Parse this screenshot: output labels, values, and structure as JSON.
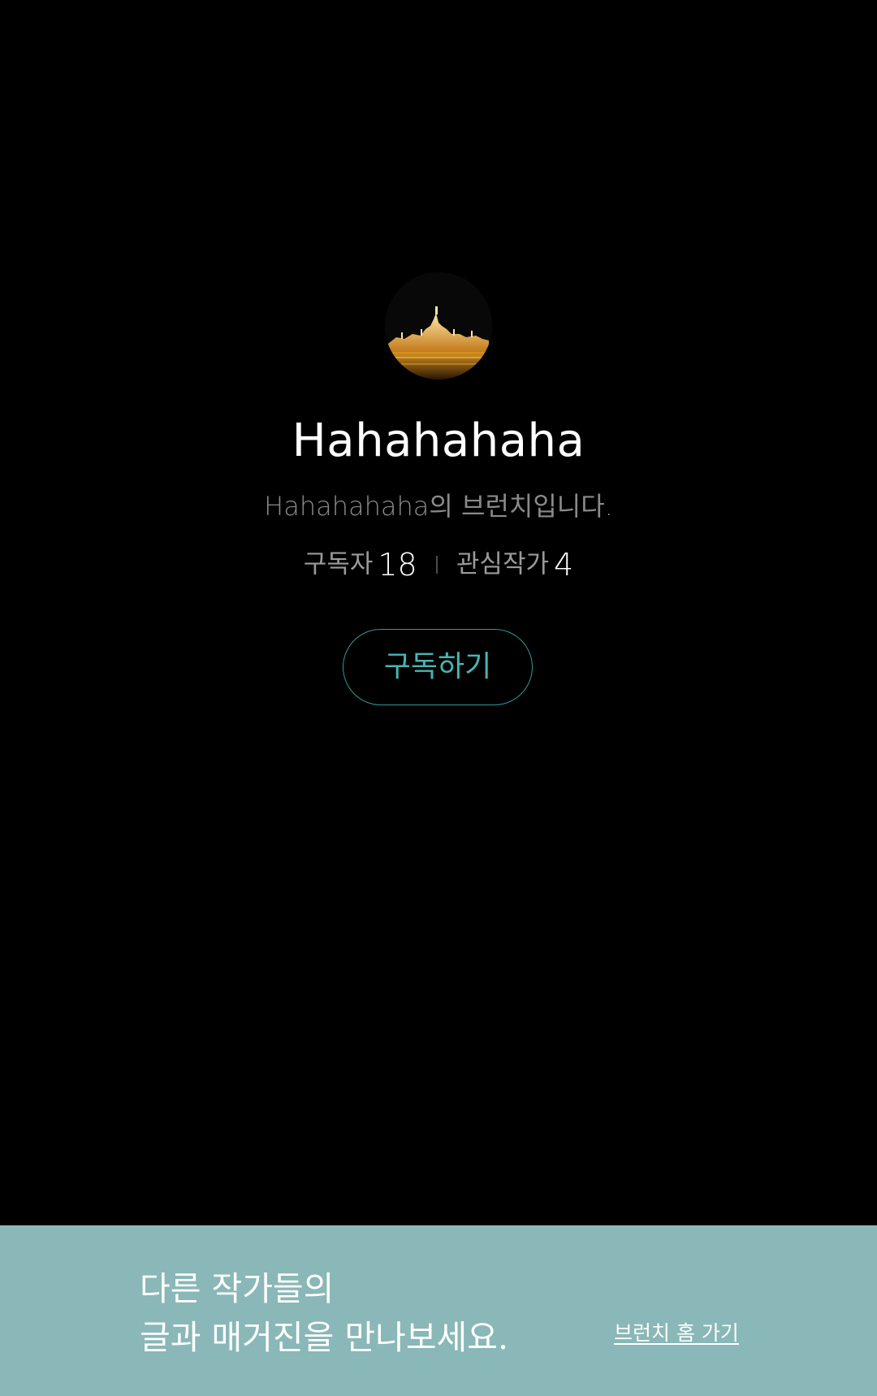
{
  "profile": {
    "avatar_icon": "budapest-parliament-night-photo",
    "name": "Hahahahaha",
    "description": "Hahahahaha의 브런치입니다.",
    "stats": {
      "subscribers_label": "구독자",
      "subscribers_count": "18",
      "following_label": "관심작가",
      "following_count": "4"
    },
    "subscribe_label": "구독하기"
  },
  "banner": {
    "line1": "다른 작가들의",
    "line2": "글과 매거진을 만나보세요.",
    "link_label": "브런치 홈 가기"
  },
  "colors": {
    "background": "#000000",
    "accent": "#47b5b2",
    "banner": "#8ab7b7"
  }
}
